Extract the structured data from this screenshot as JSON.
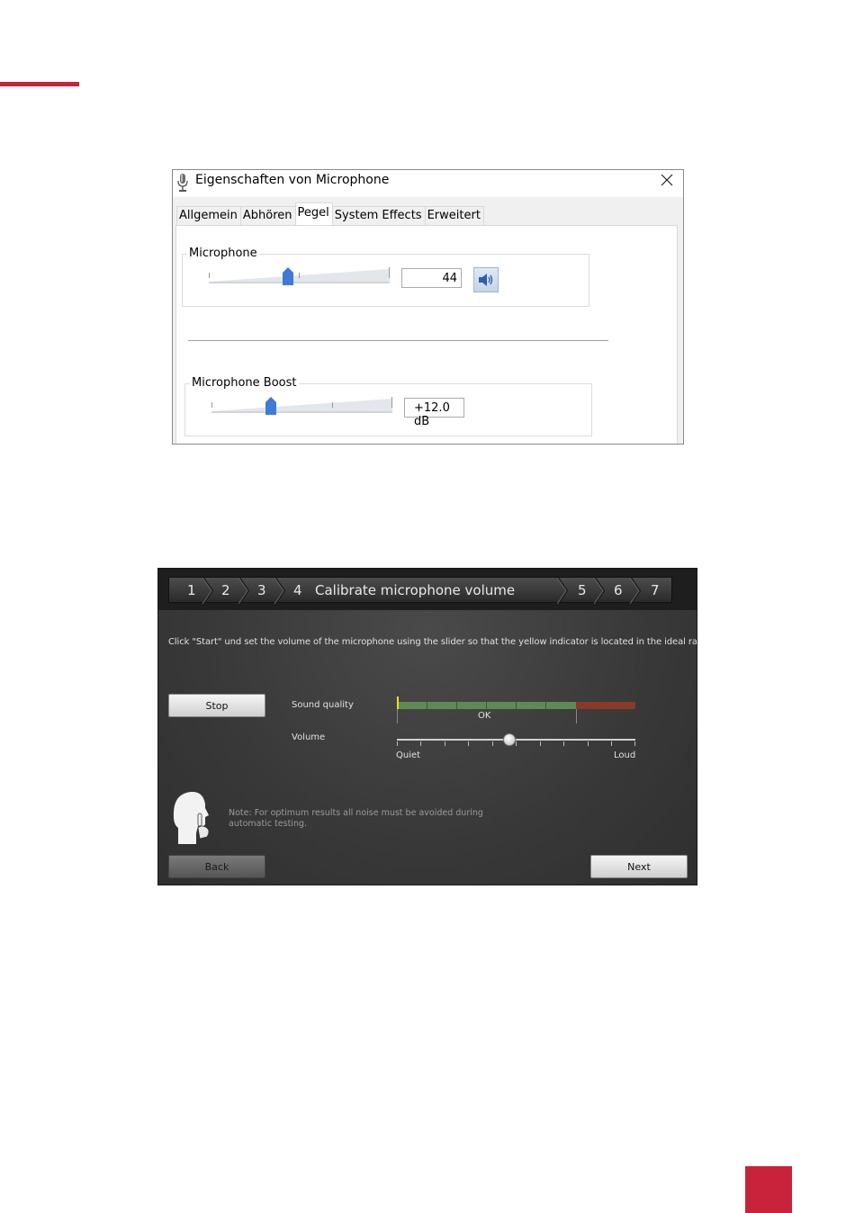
{
  "page": {
    "colors": {
      "accent": "#c8233a",
      "dialog_thumb": "#3f7ad6",
      "wizard_bg": "#3a3a3a",
      "meter_green": "#5e8a55",
      "meter_red": "#8a3a28",
      "indicator_yellow": "#f2e000"
    }
  },
  "dialog": {
    "title": "Eigenschaften von Microphone",
    "title_icon": "microphone-icon",
    "close_icon": "close-icon",
    "tabs": [
      {
        "label": "Allgemein",
        "active": false
      },
      {
        "label": "Abhören",
        "active": false
      },
      {
        "label": "Pegel",
        "active": true
      },
      {
        "label": "System Effects",
        "active": false
      },
      {
        "label": "Erweitert",
        "active": false
      }
    ],
    "microphone": {
      "label": "Microphone",
      "value": "44",
      "level": 0.44,
      "speaker_icon": "speaker-icon"
    },
    "boost": {
      "label": "Microphone Boost",
      "value": "+12.0 dB",
      "level": 0.33
    }
  },
  "wizard": {
    "steps": [
      "1",
      "2",
      "3",
      "4",
      "5",
      "6",
      "7"
    ],
    "current_step_title": "Calibrate microphone volume",
    "current_step": "4",
    "instruction": "Click \"Start\" und set the volume of the microphone using the slider so that the yellow indicator is located in the ideal range.",
    "stop_label": "Stop",
    "sound_quality_label": "Sound quality",
    "ok_label": "OK",
    "volume_label": "Volume",
    "quiet_label": "Quiet",
    "loud_label": "Loud",
    "volume_level": 0.47,
    "note": "Note: For optimum results all noise must be avoided during automatic testing.",
    "back_label": "Back",
    "next_label": "Next",
    "silhouette_icon": "quiet-person-icon"
  }
}
